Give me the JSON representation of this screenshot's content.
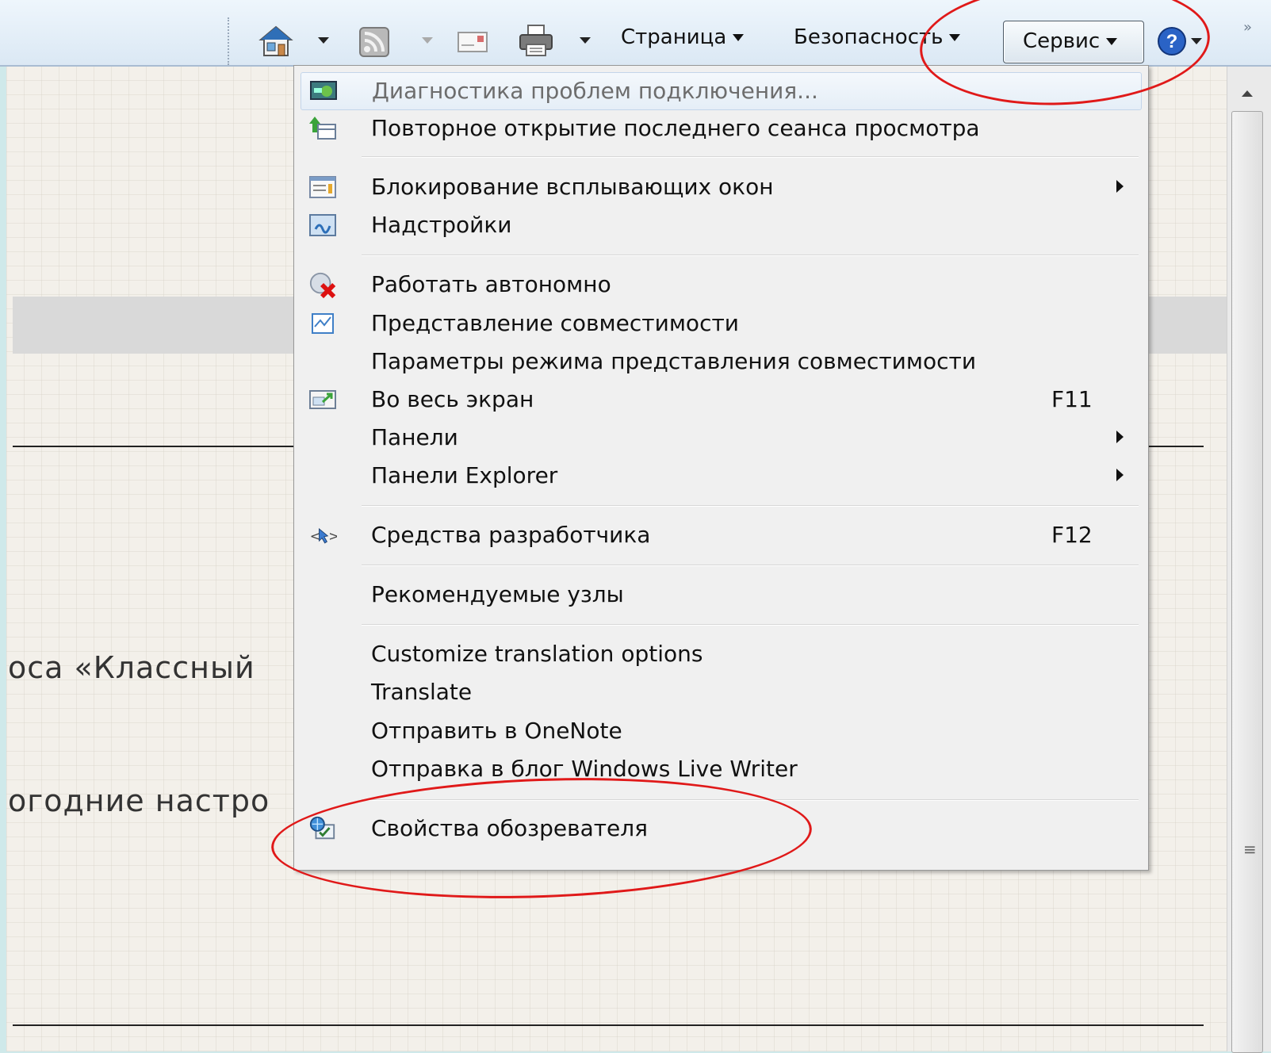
{
  "toolbar": {
    "page_label": "Страница",
    "safety_label": "Безопасность",
    "tools_label": "Сервис",
    "overflow_label": "»"
  },
  "page": {
    "line1": "оса «Классный",
    "line2": "огодние настро"
  },
  "menu": {
    "items": [
      {
        "label": "Диагностика проблем подключения...",
        "icon": "network-diagnostics-icon"
      },
      {
        "label": "Повторное открытие последнего сеанса просмотра",
        "icon": "reopen-session-icon"
      },
      {
        "label": "Блокирование всплывающих окон",
        "icon": "popup-blocker-icon"
      },
      {
        "label": "Надстройки",
        "icon": "addons-icon"
      },
      {
        "label": "Работать автономно",
        "icon": "work-offline-icon"
      },
      {
        "label": "Представление совместимости",
        "icon": "compatibility-view-icon"
      },
      {
        "label": "Параметры режима представления совместимости"
      },
      {
        "label": "Во весь экран",
        "icon": "fullscreen-icon",
        "shortcut": "F11"
      },
      {
        "label": "Панели"
      },
      {
        "label": "Панели Explorer"
      },
      {
        "label": "Средства разработчика",
        "icon": "developer-tools-icon",
        "shortcut": "F12"
      },
      {
        "label": "Рекомендуемые узлы"
      },
      {
        "label": "Customize translation options"
      },
      {
        "label": "Translate"
      },
      {
        "label": "Отправить в OneNote"
      },
      {
        "label": "Отправка в блог Windows Live Writer"
      },
      {
        "label": "Свойства обозревателя",
        "icon": "internet-options-icon"
      }
    ]
  },
  "colors": {
    "annotation": "#e01919",
    "toolbar_bg": "#dbe8f4",
    "menu_bg": "#f0f0f0"
  }
}
